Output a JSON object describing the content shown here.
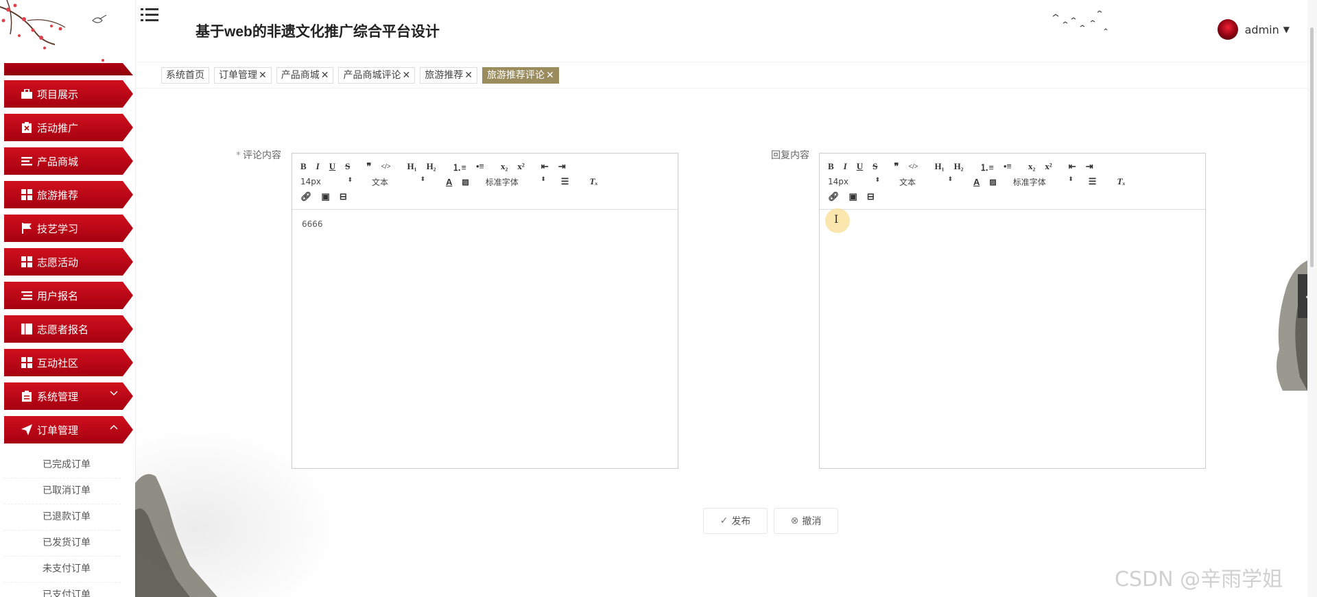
{
  "header": {
    "title": "基于web的非遗文化推广综合平台设计",
    "user": {
      "name": "admin"
    }
  },
  "sidebar": {
    "items": [
      {
        "label": "项目展示",
        "icon": "briefcase-icon"
      },
      {
        "label": "活动推广",
        "icon": "clipboard-x-icon"
      },
      {
        "label": "产品商城",
        "icon": "list-icon"
      },
      {
        "label": "旅游推荐",
        "icon": "grid-icon"
      },
      {
        "label": "技艺学习",
        "icon": "flag-icon"
      },
      {
        "label": "志愿活动",
        "icon": "grid-icon"
      },
      {
        "label": "用户报名",
        "icon": "list-icon"
      },
      {
        "label": "志愿者报名",
        "icon": "book-icon"
      },
      {
        "label": "互动社区",
        "icon": "grid-icon"
      },
      {
        "label": "系统管理",
        "icon": "clipboard-icon",
        "arrow": "chevron-down-icon"
      },
      {
        "label": "订单管理",
        "icon": "send-icon",
        "arrow": "chevron-up-icon"
      }
    ],
    "submenu": [
      "已完成订单",
      "已取消订单",
      "已退款订单",
      "已发货订单",
      "未支付订单",
      "已支付订单"
    ]
  },
  "tabs": [
    {
      "label": "系统首页",
      "closable": false,
      "active": false
    },
    {
      "label": "订单管理",
      "closable": true,
      "active": false
    },
    {
      "label": "产品商城",
      "closable": true,
      "active": false
    },
    {
      "label": "产品商城评论",
      "closable": true,
      "active": false
    },
    {
      "label": "旅游推荐",
      "closable": true,
      "active": false
    },
    {
      "label": "旅游推荐评论",
      "closable": true,
      "active": true
    }
  ],
  "form": {
    "comment_label": "评论内容",
    "comment_required_mark": "*",
    "reply_label": "回复内容",
    "comment_content": "6666",
    "reply_content": ""
  },
  "editor_toolbar": {
    "font_size": "14px",
    "block_type": "文本",
    "font_family": "标准字体",
    "select_arrow": "⬍"
  },
  "buttons": {
    "publish": "发布",
    "cancel": "撤消"
  },
  "watermark": "CSDN @辛雨学姐",
  "colors": {
    "menu_red": "#c4001a",
    "active_tab": "#9b8c5e"
  }
}
